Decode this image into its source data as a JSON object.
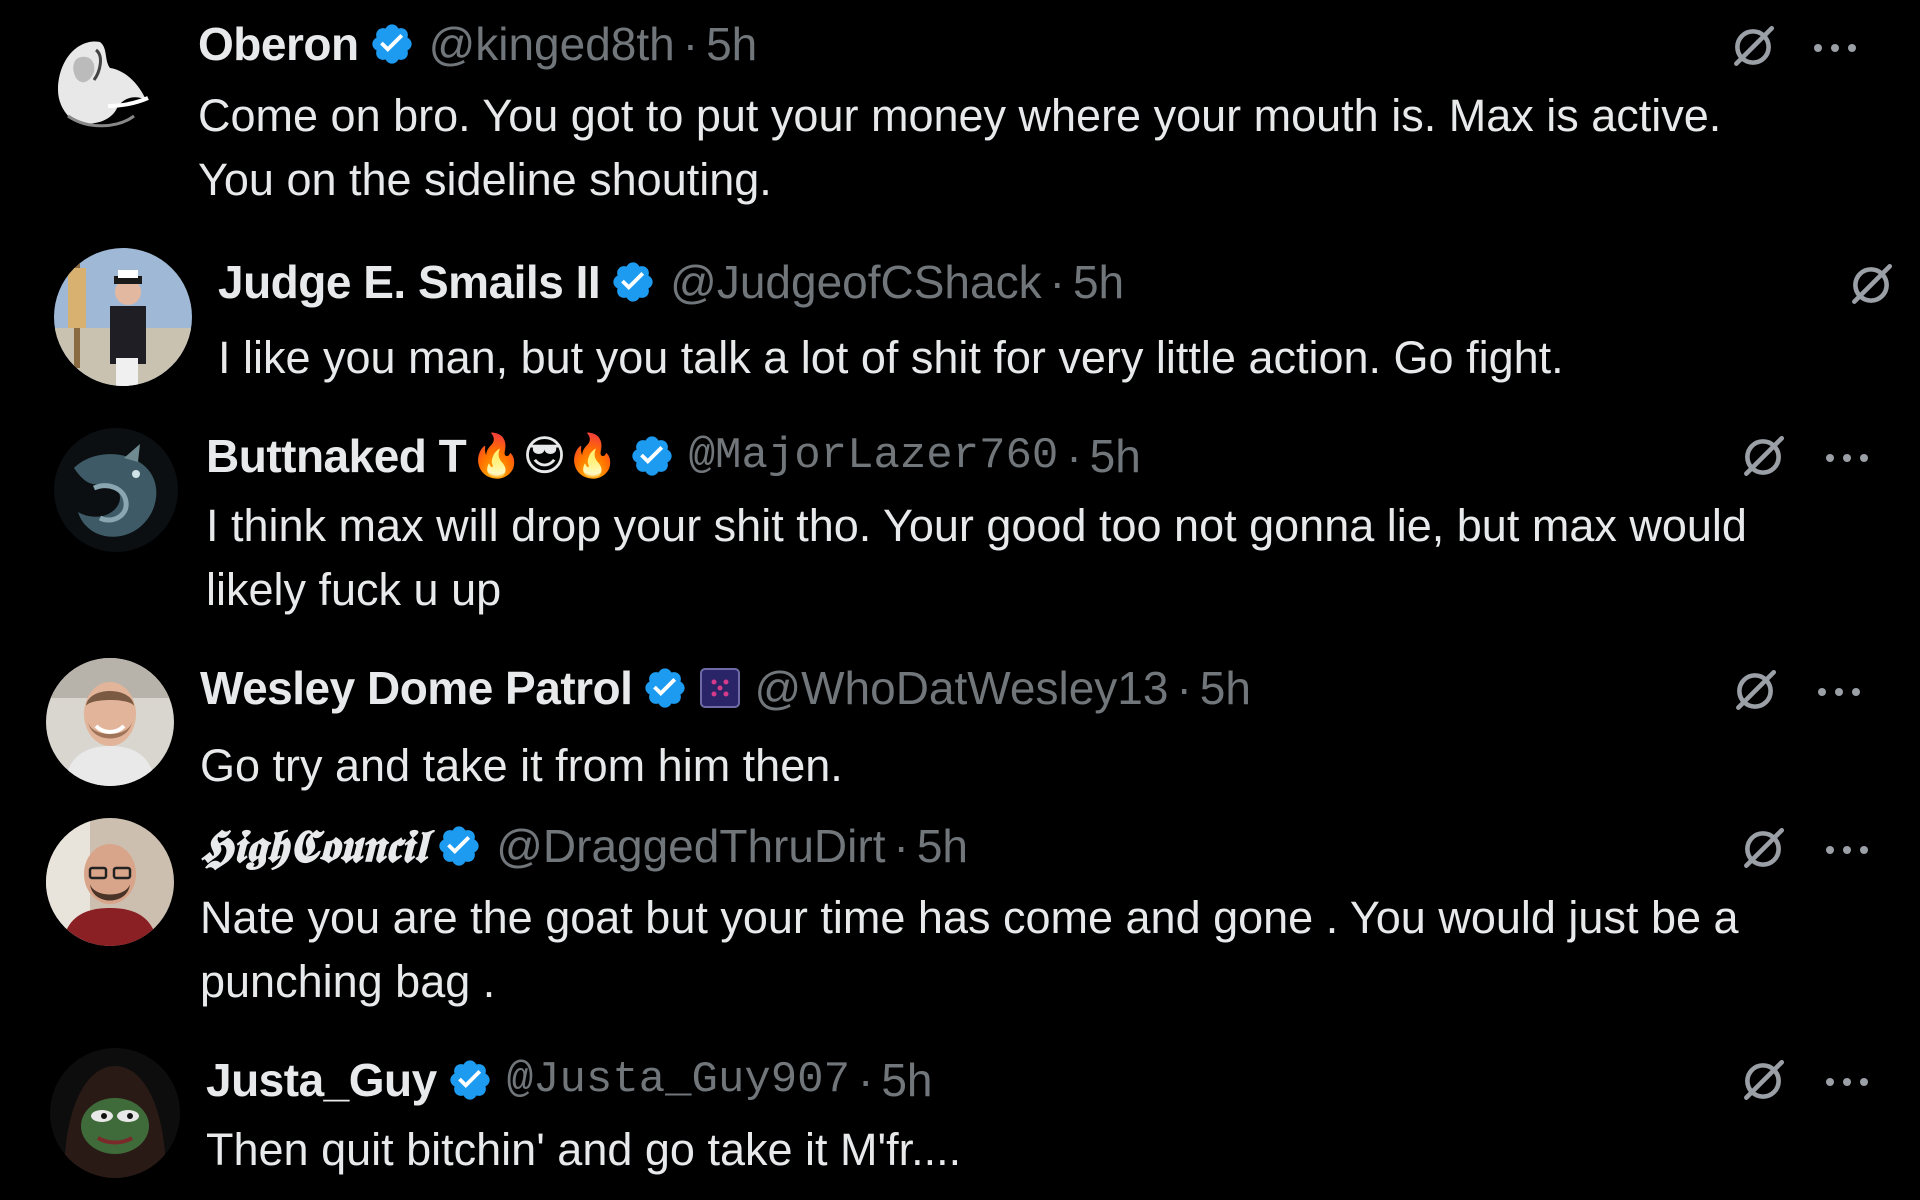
{
  "colors": {
    "background": "#000000",
    "text": "#e7e9ea",
    "muted": "#71767b",
    "verified": "#1d9bf0"
  },
  "replies": [
    {
      "display_name": "Oberon",
      "handle": "@kinged8th",
      "separator": "·",
      "time": "5h",
      "text": "Come on bro. You got to put your money where your mouth is. Max is active. You on the sideline shouting.",
      "verified": true,
      "avatar_icon": "horse-sketch-avatar"
    },
    {
      "display_name": "Judge E. Smails II",
      "handle": "@JudgeofCShack",
      "separator": "·",
      "time": "5h",
      "text": "I like you man, but you talk a lot of shit for very little action. Go fight.",
      "verified": true,
      "avatar_icon": "captain-on-dock-avatar"
    },
    {
      "display_name": "Buttnaked T",
      "name_emoji": "🔥😎🔥",
      "handle": "@MajorLazer760",
      "separator": "·",
      "time": "5h",
      "text": "I think max will drop your shit tho. Your good too not gonna lie, but max would likely fuck u up",
      "verified": true,
      "avatar_icon": "dragon-avatar"
    },
    {
      "display_name": "Wesley Dome Patrol",
      "handle": "@WhoDatWesley13",
      "separator": "·",
      "time": "5h",
      "text": "Go try and take it from him then.",
      "verified": true,
      "affiliate_icon": "square-affiliate-icon",
      "avatar_icon": "smiling-man-avatar"
    },
    {
      "display_name": "𝕳𝖎𝖌𝖍𝕮𝖔𝖚𝖓𝖈𝖎𝖑",
      "handle": "@DraggedThruDirt",
      "separator": "·",
      "time": "5h",
      "text": "Nate you are the goat but your time has come and gone . You would just be a punching bag .",
      "verified": true,
      "avatar_icon": "bald-man-glasses-avatar"
    },
    {
      "display_name": "Justa_Guy",
      "handle": "@Justa_Guy907",
      "separator": "·",
      "time": "5h",
      "text": "Then quit bitchin' and go take it M'fr....",
      "verified": true,
      "avatar_icon": "hooded-frog-avatar"
    }
  ]
}
